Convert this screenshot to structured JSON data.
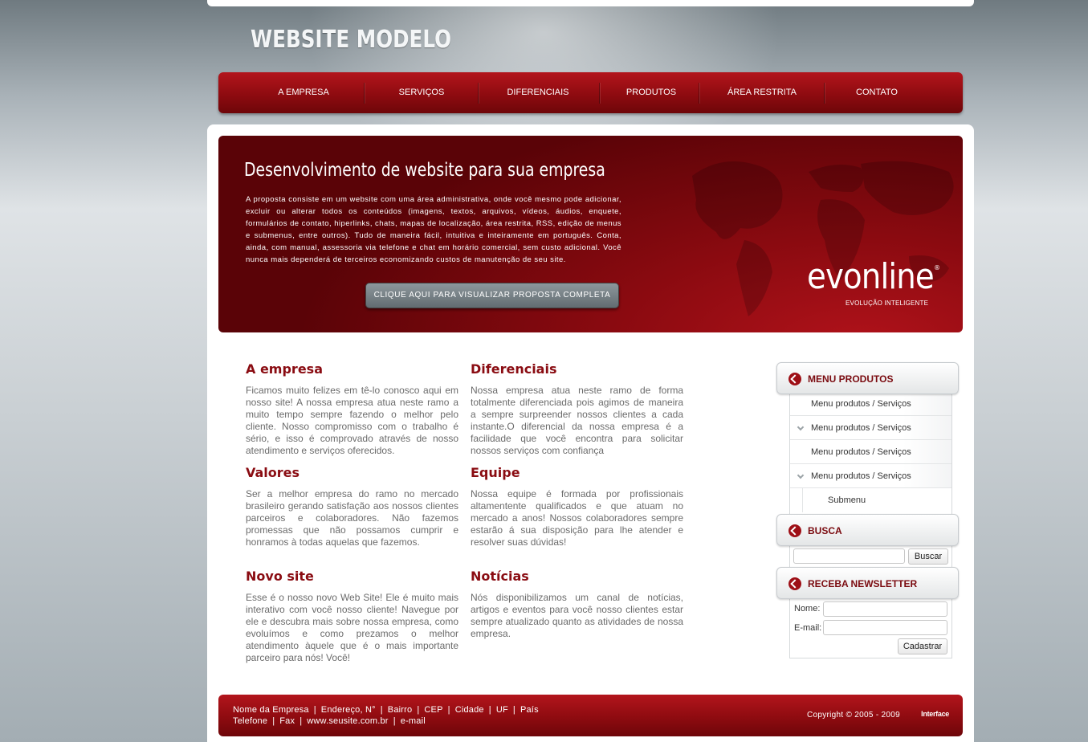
{
  "header": {
    "logo_text": "WEBSITE MODELO"
  },
  "nav": {
    "items": [
      {
        "label": "A EMPRESA"
      },
      {
        "label": "SERVIÇOS"
      },
      {
        "label": "DIFERENCIAIS"
      },
      {
        "label": "PRODUTOS"
      },
      {
        "label": "ÁREA RESTRITA"
      },
      {
        "label": "CONTATO"
      }
    ]
  },
  "banner": {
    "title": "Desenvolvimento de website para sua empresa",
    "text": "A proposta consiste em um website com uma área administrativa, onde você mesmo pode adicionar, excluir ou alterar todos os conteúdos (imagens, textos, arquivos, vídeos, áudios, enquete, formulários de contato, hiperlinks, chats, mapas de localização, área restrita, RSS, edição de menus e submenus, entre outros). Tudo de maneira fácil, intuitiva e inteiramente em português. Conta, ainda, com manual, assessoria via telefone e chat em horário comercial, sem custo adicional. Você nunca mais dependerá de terceiros economizando custos de manutenção de seu site.",
    "button_label": "CLIQUE AQUI PARA VISUALIZAR PROPOSTA COMPLETA",
    "brand_name": "evonline",
    "brand_reg": "®",
    "brand_tagline": "EVOLUÇÃO INTELIGENTE"
  },
  "content": {
    "left": [
      {
        "title": "A empresa",
        "text": "Ficamos muito felizes em tê-lo conosco aqui em nosso site! A nossa empresa atua neste ramo a muito tempo sempre fazendo o melhor pelo cliente. Nosso compromisso com o trabalho é sério, e isso é comprovado através de nosso atendimento e serviços oferecidos."
      },
      {
        "title": "Valores",
        "text": "Ser a melhor empresa do ramo no mercado brasileiro gerando satisfação aos nossos clientes parceiros e colaboradores. Não fazemos promessas que não possamos cumprir e honramos à todas aquelas que fazemos."
      },
      {
        "title": "Novo site",
        "text": "Esse é o nosso novo Web Site! Ele é muito mais interativo com você nosso cliente! Navegue por ele e descubra mais sobre nossa empresa, como evoluímos e como prezamos o melhor atendimento àquele que é o mais importante parceiro para nós! Você!"
      }
    ],
    "right": [
      {
        "title": "Diferenciais",
        "text": "Nossa empresa atua neste ramo de forma totalmente diferenciada pois agimos de maneira a sempre surpreender nossos clientes a cada instante.O diferencial da nossa empresa é a facilidade que você encontra para solicitar nossos serviços com confiança"
      },
      {
        "title": "Equipe",
        "text": "Nossa equipe é formada por profissionais altamentente qualificados e que atuam no mercado a anos! Nossos colaboradores sempre estarão á sua disposição para lhe atender e resolver suas dúvidas!"
      },
      {
        "title": "Notícias",
        "text": "Nós disponibilizamos um canal de notícias, artigos e eventos para você nosso clientes estar sempre atualizado quanto as atividades de nossa empresa."
      }
    ]
  },
  "sidebar": {
    "menu_title": "MENU PRODUTOS",
    "menu_items": [
      {
        "label": "Menu produtos / Serviços"
      },
      {
        "label": "Menu produtos / Serviços"
      },
      {
        "label": "Menu produtos / Serviços"
      },
      {
        "label": "Menu produtos / Serviços"
      }
    ],
    "submenu_label": "Submenu",
    "search_title": "BUSCA",
    "search_value": "",
    "search_button": "Buscar",
    "newsletter_title": "RECEBA NEWSLETTER",
    "name_label": "Nome:",
    "name_value": "",
    "email_label": "E-mail:",
    "email_value": "",
    "newsletter_button": "Cadastrar"
  },
  "footer": {
    "line1": [
      "Nome da Empresa",
      "Endereço, N°",
      "Bairro",
      "CEP",
      "Cidade",
      "UF",
      "País"
    ],
    "line2": [
      "Telefone",
      "Fax",
      "www.seusite.com.br",
      "e-mail"
    ],
    "separator": "|",
    "copyright": "Copyright © 2005 - 2009",
    "developer_logo": "Interface"
  },
  "colors": {
    "brand_red": "#8e0b10",
    "title_red": "#8a0c12",
    "body_text": "#6b6b6b"
  }
}
